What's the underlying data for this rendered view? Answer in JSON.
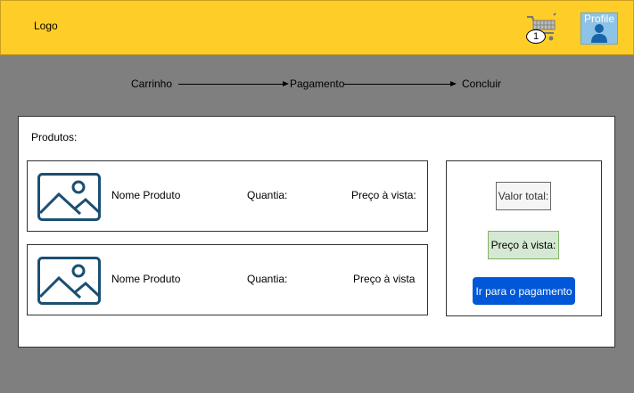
{
  "header": {
    "logo": "Logo",
    "cart_icon": "shopping-cart-icon",
    "cart_count": "1",
    "profile_label": "Profile",
    "profile_icon": "user-icon"
  },
  "steps": [
    "Carrinho",
    "Pagamento",
    "Concluir"
  ],
  "products_title": "Produtos:",
  "products": [
    {
      "image_icon": "image-placeholder-icon",
      "name": "Nome Produto",
      "qty_label": "Quantia:",
      "price_label": "Preço à vista:"
    },
    {
      "image_icon": "image-placeholder-icon",
      "name": "Nome Produto",
      "qty_label": "Quantia:",
      "price_label": "Preço à vista"
    }
  ],
  "summary": {
    "total_label": "Valor total:",
    "cash_price_label": "Preço à vista:",
    "pay_button": "Ir para o pagamento"
  },
  "colors": {
    "header_bg": "#ffcd28",
    "page_bg": "#7f7f7f",
    "button_bg": "#0057d8",
    "cash_bg": "#d5e8d4",
    "icon_color": "#1b4f72"
  }
}
